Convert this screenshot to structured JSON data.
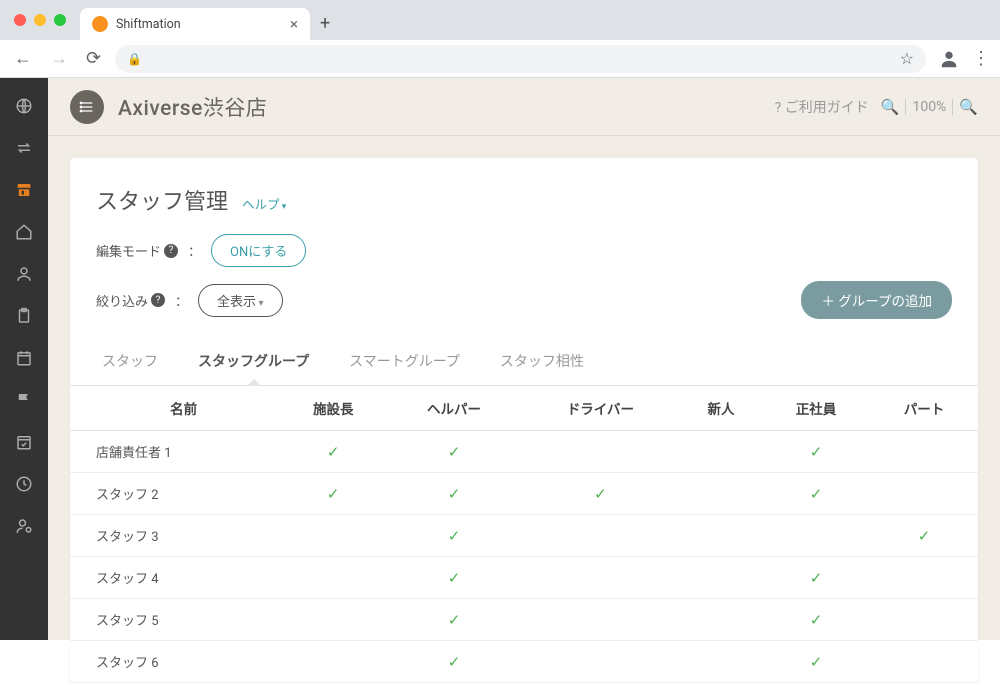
{
  "browser": {
    "tab_title": "Shiftmation"
  },
  "topbar": {
    "store_name": "Axiverse渋谷店",
    "guide_label": "ご利用ガイド",
    "zoom_level": "100%"
  },
  "page": {
    "title": "スタッフ管理",
    "help_label": "ヘルプ",
    "edit_mode_label": "編集モード",
    "edit_mode_button": "ONにする",
    "filter_label": "絞り込み",
    "filter_value": "全表示",
    "add_group_label": "＋ グループの追加"
  },
  "tabs": [
    {
      "label": "スタッフ",
      "active": false
    },
    {
      "label": "スタッフグループ",
      "active": true
    },
    {
      "label": "スマートグループ",
      "active": false
    },
    {
      "label": "スタッフ相性",
      "active": false
    }
  ],
  "table": {
    "columns": [
      "名前",
      "施設長",
      "ヘルパー",
      "ドライバー",
      "新人",
      "正社員",
      "パート"
    ],
    "rows": [
      {
        "name": "店舗責任者 1",
        "vals": [
          true,
          true,
          false,
          false,
          true,
          false
        ]
      },
      {
        "name": "スタッフ 2",
        "vals": [
          true,
          true,
          true,
          false,
          true,
          false
        ]
      },
      {
        "name": "スタッフ 3",
        "vals": [
          false,
          true,
          false,
          false,
          false,
          true
        ]
      },
      {
        "name": "スタッフ 4",
        "vals": [
          false,
          true,
          false,
          false,
          true,
          false
        ]
      },
      {
        "name": "スタッフ 5",
        "vals": [
          false,
          true,
          false,
          false,
          true,
          false
        ]
      },
      {
        "name": "スタッフ 6",
        "vals": [
          false,
          true,
          false,
          false,
          true,
          false
        ]
      }
    ]
  },
  "sidebar_icons": [
    "globe-icon",
    "transfer-icon",
    "store-icon",
    "home-icon",
    "user-icon",
    "clipboard-icon",
    "calendar-icon",
    "flag-icon",
    "calendar-check-icon",
    "clock-icon",
    "user-cog-icon"
  ]
}
